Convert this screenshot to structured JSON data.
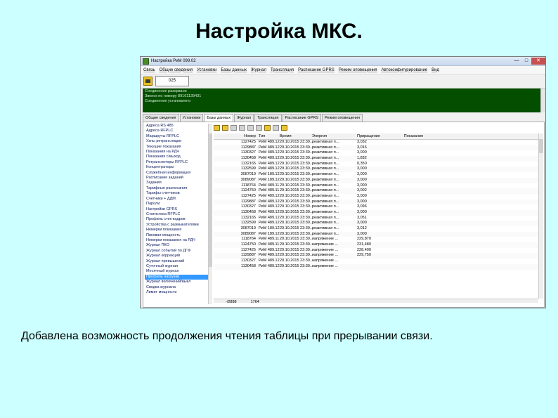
{
  "slide": {
    "title": "Настройка МКС.",
    "caption": "Добавлена возможность продолжения чтения таблицы при прерывании связи."
  },
  "window": {
    "title": "Настройка РиМ 099.02",
    "menu": [
      "Связь",
      "Общие сведения",
      "Установки",
      "Базы данных",
      "Журнал",
      "Трансляция",
      "Расписание GPRS",
      "Режим оповещения",
      "Автоконфигурирование",
      "Вид"
    ],
    "toolbar": {
      "button_label": "025"
    },
    "log": [
      "Соединение разорвано",
      "Звонок по номеру 89161139431",
      "Соединение установлено"
    ],
    "tabs": [
      "Общие сведения",
      "Установки",
      "Базы данных",
      "Журнал",
      "Трансляция",
      "Расписание GPRS",
      "Режим оповещения"
    ],
    "active_tab_index": 2,
    "sidebar": [
      "Адреса RS 485",
      "Адреса RFPLC",
      "Маршруты RFPLC",
      "Узлы ретрансляции",
      "Текущие показания",
      "Показания на РДЧ",
      "Показания с/выход",
      "Ретрансляторы RFPLC",
      "Концентраторы",
      "Служебная информация",
      "Расписание заданий",
      "Задания",
      "Тарифные расписания",
      "Тарифы счетчиков",
      "Счетчики + ДДМ",
      "Пароли",
      "Настройки GPRS",
      "Статистика RFPLC",
      "Профиль стек-кадров",
      "Устройства с размыкателями",
      "Немерки показания",
      "Пиковая мощность",
      "Немерки показания на РДЧ",
      "Журнал ПКО",
      "Журнал событий по ДГФ",
      "Журнал коррекций",
      "Журнал превышений",
      "Суточный журнал",
      "Месячный журнал",
      "Профиль нагрузки",
      "Журнал включений/выкл",
      "Сводка журнала",
      "Лимит мощности"
    ],
    "selected_sidebar_index": 29,
    "grid": {
      "columns": [
        "Номер",
        "Тип",
        "Время",
        "Энергия",
        "Приращение",
        "Показания"
      ],
      "rows": [
        [
          "1127425",
          "РиМ 489.12",
          "29.10.2015 23:30...",
          "реактивная п...",
          "3,032",
          ""
        ],
        [
          "1129887",
          "РиМ 489.12",
          "29.10.2015 23:30...",
          "реактивная п...",
          "3,016",
          ""
        ],
        [
          "1130327",
          "РиМ 489.12",
          "29.10.2015 23:30...",
          "реактивная п...",
          "3,000",
          ""
        ],
        [
          "1130458",
          "РиМ 489.12",
          "29.10.2015 23:30...",
          "реактивная п...",
          "1,832",
          ""
        ],
        [
          "1132165",
          "РиМ 489.12",
          "29.10.2015 23:30...",
          "реактивная п...",
          "0,350",
          ""
        ],
        [
          "1132599",
          "РиМ 489.12",
          "29.10.2015 23:30...",
          "реактивная п...",
          "3,000",
          ""
        ],
        [
          "3087019",
          "РиМ 189.12",
          "29.10.2015 23:30...",
          "реактивная п...",
          "3,000",
          ""
        ],
        [
          "3089087",
          "РиМ 189.12",
          "29.10.2015 23:30...",
          "реактивная п...",
          "3,000",
          ""
        ],
        [
          "1118764",
          "РиМ 489.11",
          "29.10.2015 23:30...",
          "реактивная п...",
          "3,000",
          ""
        ],
        [
          "1124750",
          "РиМ 489.11",
          "29.10.2015 23:30...",
          "реактивная п...",
          "3,002",
          ""
        ],
        [
          "1127425",
          "РиМ 489.12",
          "29.10.2015 23:30...",
          "реактивная п...",
          "3,000",
          ""
        ],
        [
          "1129887",
          "РиМ 489.12",
          "29.10.2015 23:30...",
          "реактивная п...",
          "3,000",
          ""
        ],
        [
          "1130327",
          "РиМ 489.12",
          "29.10.2015 23:30...",
          "реактивная п...",
          "3,096",
          ""
        ],
        [
          "1130458",
          "РиМ 489.12",
          "29.10.2015 23:30...",
          "реактивная п...",
          "3,000",
          ""
        ],
        [
          "1132165",
          "РиМ 489.12",
          "29.10.2015 23:30...",
          "реактивная п...",
          "3,051",
          ""
        ],
        [
          "1132599",
          "РиМ 489.12",
          "29.10.2015 23:30...",
          "реактивная п...",
          "3,000",
          ""
        ],
        [
          "3087019",
          "РиМ 189.12",
          "29.10.2015 23:30...",
          "реактивная п...",
          "3,012",
          ""
        ],
        [
          "3089087",
          "РиМ 189.12",
          "29.10.2015 23:30...",
          "реактивная п...",
          "3,000",
          ""
        ],
        [
          "1118764",
          "РиМ 489.11",
          "29.10.2015 23:30...",
          "напряжение ...",
          "229,870",
          ""
        ],
        [
          "1124750",
          "РиМ 489.11",
          "29.10.2015 23:30...",
          "напряжение ...",
          "231,480",
          ""
        ],
        [
          "1127425",
          "РиМ 489.12",
          "29.10.2015 23:30...",
          "напряжение ...",
          "228,400",
          ""
        ],
        [
          "1129887",
          "РиМ 489.12",
          "29.10.2015 23:30...",
          "напряжение ...",
          "229,750",
          ""
        ],
        [
          "1130327",
          "РиМ 489.12",
          "29.10.2015 23:30...",
          "напряжение ...",
          "",
          ""
        ],
        [
          "1130458",
          "РиМ 489.12",
          "29.10.2015 23:30...",
          "напряжение ...",
          "",
          ""
        ]
      ]
    },
    "status": {
      "left": "-/2888",
      "right": "1764"
    },
    "colors": {
      "log_bg": "#044e00",
      "selection": "#3399ff",
      "slide_bg": "#ccffff"
    }
  }
}
